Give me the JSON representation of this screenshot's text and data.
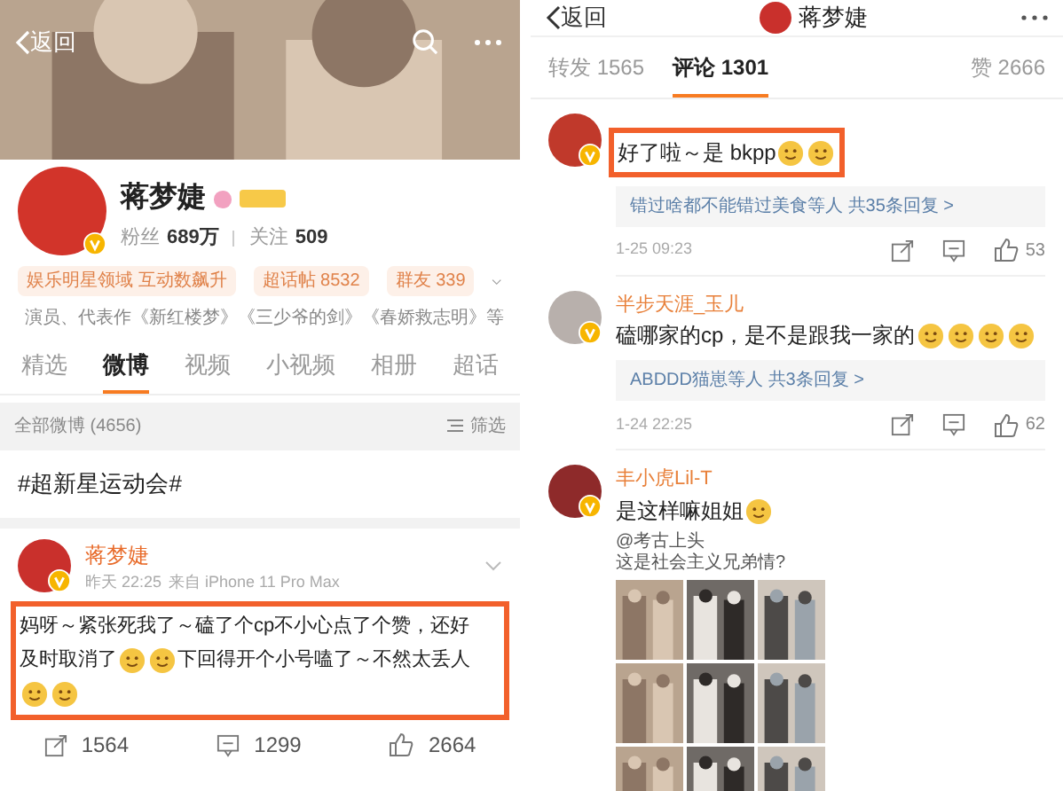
{
  "left": {
    "back": "返回",
    "profile": {
      "name": "蒋梦婕",
      "followers_label": "粉丝",
      "followers": "689万",
      "following_label": "关注",
      "following": "509",
      "tags": [
        "娱乐明星领域 互动数飙升",
        "超话帖 8532",
        "群友 339"
      ],
      "bio": "演员、代表作《新红楼梦》《三少爷的剑》《春娇救志明》等"
    },
    "tabs": [
      {
        "label": "精选",
        "selected": false
      },
      {
        "label": "微博",
        "selected": true
      },
      {
        "label": "视频",
        "selected": false
      },
      {
        "label": "小视频",
        "selected": false
      },
      {
        "label": "相册",
        "selected": false
      },
      {
        "label": "超话",
        "selected": false
      }
    ],
    "feed_bar": {
      "count": "全部微博 (4656)",
      "filter": "筛选"
    },
    "topic": "#超新星运动会#",
    "post": {
      "author": "蒋梦婕",
      "time": "昨天 22:25",
      "source": "来自 iPhone 11 Pro Max",
      "highlighted": true,
      "segments": [
        {
          "kind": "text",
          "text": "妈呀～紧张死我了～磕了个cp不小心点了个赞，还好"
        },
        {
          "kind": "text",
          "text": "及时取消了"
        },
        {
          "kind": "emoji"
        },
        {
          "kind": "emoji"
        },
        {
          "kind": "text",
          "text": "下回得开个小号嗑了～不然太丢人"
        },
        {
          "kind": "emoji"
        },
        {
          "kind": "emoji"
        }
      ],
      "actions": [
        {
          "kind": "repost",
          "count": "1564"
        },
        {
          "kind": "comment",
          "count": "1299"
        },
        {
          "kind": "like",
          "count": "2664"
        }
      ]
    }
  },
  "right": {
    "back": "返回",
    "title": "蒋梦婕",
    "tabs": [
      {
        "label": "转发 1565",
        "selected": false
      },
      {
        "label": "评论 1301",
        "selected": true
      },
      {
        "label": "赞 2666",
        "selected": false
      }
    ],
    "comments": [
      {
        "highlighted": true,
        "segments": [
          {
            "kind": "text",
            "text": "好了啦～是 bkpp"
          },
          {
            "kind": "emoji"
          },
          {
            "kind": "emoji"
          }
        ],
        "replies": "错过啥都不能错过美食等人 共35条回复 >",
        "time": "1-25 09:23",
        "likes": "53"
      },
      {
        "author": "半步天涯_玉儿",
        "highlighted": false,
        "segments": [
          {
            "kind": "text",
            "text": "磕哪家的cp，是不是跟我一家的"
          },
          {
            "kind": "emoji"
          },
          {
            "kind": "emoji"
          },
          {
            "kind": "emoji"
          },
          {
            "kind": "emoji"
          }
        ],
        "replies": "ABDDD猫崽等人 共3条回复 >",
        "time": "1-24 22:25",
        "likes": "62"
      },
      {
        "author": "丰小虎Lil-T",
        "highlighted": false,
        "segments": [
          {
            "kind": "text",
            "text": "是这样嘛姐姐"
          },
          {
            "kind": "emoji"
          }
        ],
        "caption": [
          "@考古上头",
          "这是社会主义兄弟情?"
        ],
        "photos": [
          {
            "kind": "picture"
          },
          {
            "kind": "picture"
          },
          {
            "kind": "picture"
          },
          {
            "kind": "picture"
          },
          {
            "kind": "picture"
          },
          {
            "kind": "picture"
          },
          {
            "kind": "picture"
          },
          {
            "kind": "picture"
          },
          {
            "kind": "picture"
          }
        ]
      }
    ]
  }
}
